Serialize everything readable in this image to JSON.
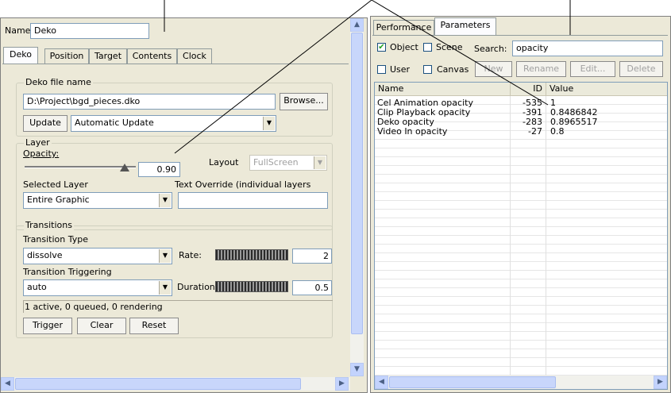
{
  "left": {
    "name_label": "Name:",
    "name_value": "Deko",
    "tabs": [
      "Deko",
      "Position",
      "Target",
      "Contents",
      "Clock"
    ],
    "deko_file": {
      "legend": "Deko file name",
      "path": "D:\\Project\\bgd_pieces.dko",
      "browse": "Browse...",
      "update": "Update",
      "update_mode": "Automatic Update"
    },
    "layer": {
      "legend": "Layer",
      "opacity_label": "Opacity:",
      "opacity_value": "0.90",
      "opacity_fraction": 0.9,
      "layout_label": "Layout",
      "layout_value": "FullScreen",
      "selected_layer_label": "Selected Layer",
      "selected_layer_value": "Entire Graphic",
      "text_override_label": "Text Override (individual layers"
    },
    "transitions": {
      "legend": "Transitions",
      "type_label": "Transition Type",
      "type_value": "dissolve",
      "rate_label": "Rate:",
      "rate_value": "2",
      "triggering_label": "Transition Triggering",
      "triggering_value": "auto",
      "duration_label": "Duration:",
      "duration_value": "0.5",
      "status": "1 active, 0 queued, 0 rendering",
      "trigger": "Trigger",
      "clear": "Clear",
      "reset": "Reset"
    }
  },
  "right": {
    "tabs": [
      "Performance",
      "Parameters"
    ],
    "object_label": "Object",
    "object_checked": true,
    "scene_label": "Scene",
    "scene_checked": false,
    "search_label": "Search:",
    "search_value": "opacity",
    "user_label": "User",
    "canvas_label": "Canvas",
    "buttons": [
      "New",
      "Rename",
      "Edit...",
      "Delete"
    ],
    "columns": [
      "Name",
      "ID",
      "Value"
    ],
    "rows": [
      {
        "name": "Cel Animation opacity",
        "id": "-535",
        "value": "1"
      },
      {
        "name": "Clip Playback opacity",
        "id": "-391",
        "value": "0.8486842"
      },
      {
        "name": "Deko  opacity",
        "id": "-283",
        "value": "0.8965517"
      },
      {
        "name": "Video In opacity",
        "id": "-27",
        "value": "0.8"
      }
    ]
  },
  "colors": {
    "panel_bg": "#ece9d8",
    "border": "#7f7f7f",
    "input_border": "#7f9db9",
    "scrollbar": "#c3d3fd"
  }
}
